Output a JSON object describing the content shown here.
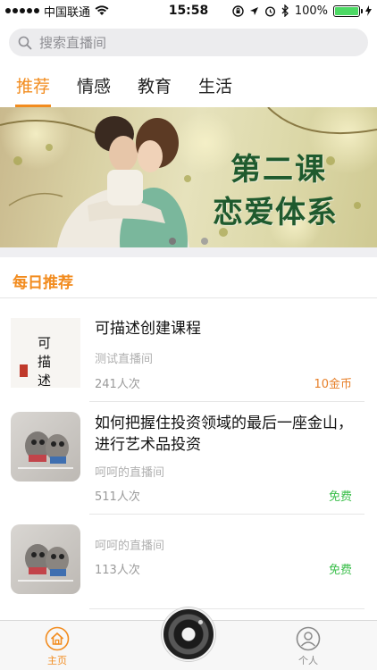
{
  "status_bar": {
    "carrier": "中国联通",
    "time": "15:58",
    "battery": "100%",
    "battery_level": 1.0
  },
  "search": {
    "placeholder": "搜索直播间"
  },
  "tabs": [
    {
      "label": "推荐",
      "active": true
    },
    {
      "label": "情感",
      "active": false
    },
    {
      "label": "教育",
      "active": false
    },
    {
      "label": "生活",
      "active": false
    }
  ],
  "banner": {
    "line1": "第二课",
    "line2": "恋爱体系",
    "dots": 2,
    "active_dot": 0
  },
  "section": {
    "title": "每日推荐"
  },
  "items": [
    {
      "title": "可描述创建课程",
      "room": "测试直播间",
      "count": "241人次",
      "price": "10金币",
      "price_type": "coin",
      "thumb": "calligraphy"
    },
    {
      "title": "如何把握住投资领域的最后一座金山，进行艺术品投资",
      "room": "呵呵的直播间",
      "count": "511人次",
      "price": "免费",
      "price_type": "free",
      "thumb": "plush-toys"
    },
    {
      "title": "",
      "room": "呵呵的直播间",
      "count": "113人次",
      "price": "免费",
      "price_type": "free",
      "thumb": "plush-toys"
    }
  ],
  "thumb_text": {
    "calligraphy": "可描述"
  },
  "tabbar": {
    "home_label": "主页",
    "me_label": "个人"
  },
  "colors": {
    "accent": "#f28c1f",
    "free": "#3cbf4c",
    "coin": "#e7802a"
  }
}
